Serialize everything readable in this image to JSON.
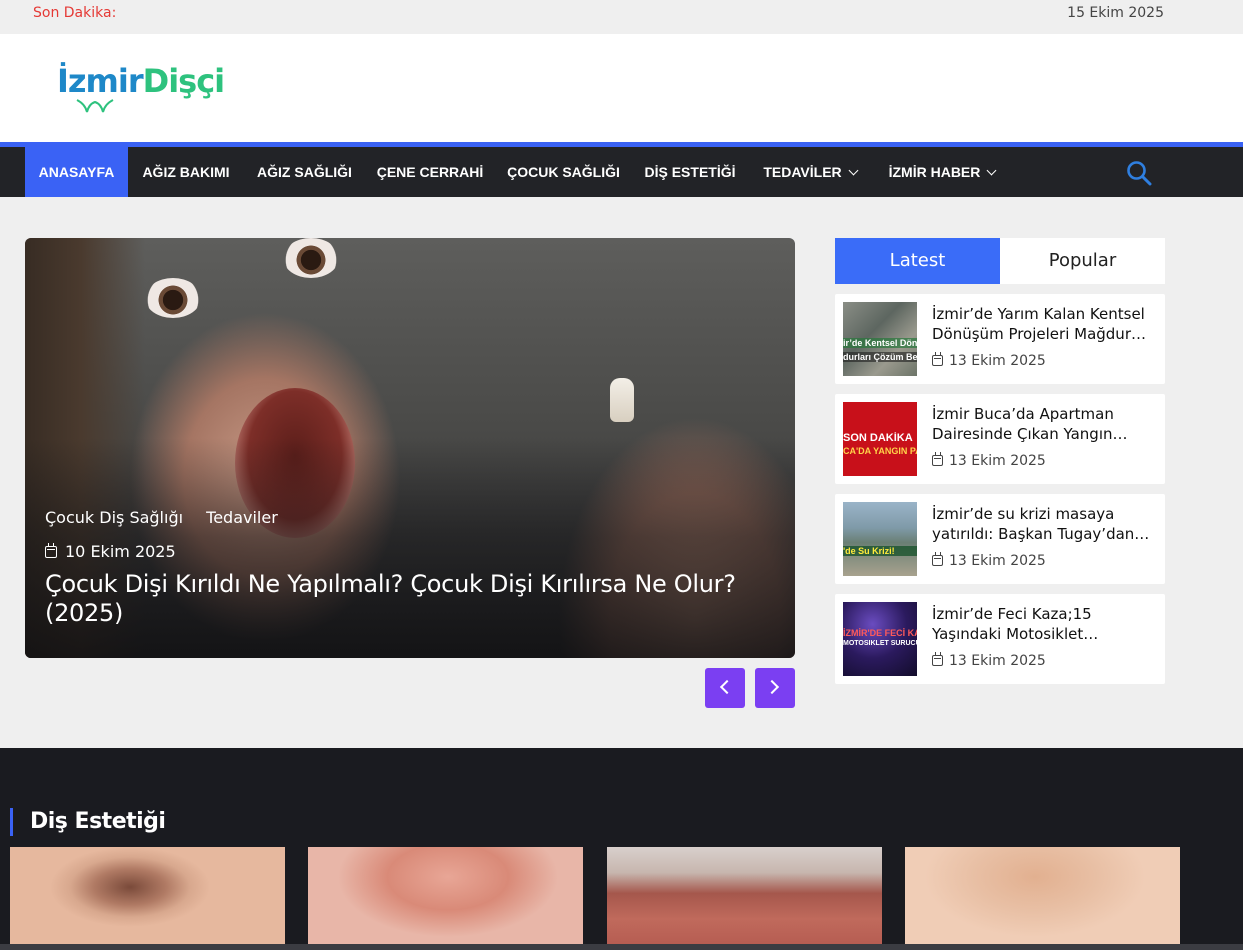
{
  "topbar": {
    "breaking_label": "Son Dakika:",
    "date": "15 Ekim 2025"
  },
  "brand": {
    "part1": "İzmir",
    "part2": "Dişçi",
    "color_primary": "#1e88c8",
    "color_secondary": "#2ec27e"
  },
  "nav": {
    "items": [
      {
        "label": "ANASAYFA",
        "active": true
      },
      {
        "label": "AĞIZ BAKIMI"
      },
      {
        "label": "AĞIZ SAĞLIĞI"
      },
      {
        "label": "ÇENE CERRAHİ"
      },
      {
        "label": "ÇOCUK SAĞLIĞI"
      },
      {
        "label": "DİŞ ESTETİĞİ"
      },
      {
        "label": "TEDAVİLER",
        "dropdown": true
      },
      {
        "label": "İZMİR HABER",
        "dropdown": true
      }
    ],
    "search_icon": "search-icon",
    "accent_color": "#3a62f5"
  },
  "hero": {
    "categories": [
      "Çocuk Diş Sağlığı",
      "Tedaviler"
    ],
    "date": "10 Ekim 2025",
    "title": "Çocuk Dişi Kırıldı Ne Yapılmalı? Çocuk Dişi Kırılırsa Ne Olur? (2025)",
    "arrow_color": "#7b3ff2"
  },
  "sidebar": {
    "tabs": [
      {
        "label": "Latest",
        "active": true
      },
      {
        "label": "Popular"
      }
    ],
    "posts": [
      {
        "title": "İzmir’de Yarım Kalan Kentsel Dönüşüm Projeleri Mağdur…",
        "date": "13 Ekim 2025",
        "thumb_text_top": "ir’de Kentsel Dönüş",
        "thumb_text_bottom": "durları Çözüm Bekl"
      },
      {
        "title": "İzmir Buca’da Apartman Dairesinde Çıkan Yangın…",
        "date": "13 Ekim 2025",
        "thumb_text_top": "SON DAKİKA",
        "thumb_text_bottom": "CA'DA YANGIN PA"
      },
      {
        "title": "İzmir’de su krizi masaya yatırıldı: Başkan Tugay’dan…",
        "date": "13 Ekim 2025",
        "thumb_text_top": "'de Su Krizi!",
        "thumb_text_bottom": ""
      },
      {
        "title": "İzmir’de Feci Kaza;15 Yaşındaki Motosiklet…",
        "date": "13 Ekim 2025",
        "thumb_text_top": "İZMİR'DE FECİ KAZA",
        "thumb_text_bottom": "MOTOSİKLET SÜRÜCÜSÜ ÖLDÜ"
      }
    ]
  },
  "section": {
    "title": "Diş Estetiği"
  }
}
